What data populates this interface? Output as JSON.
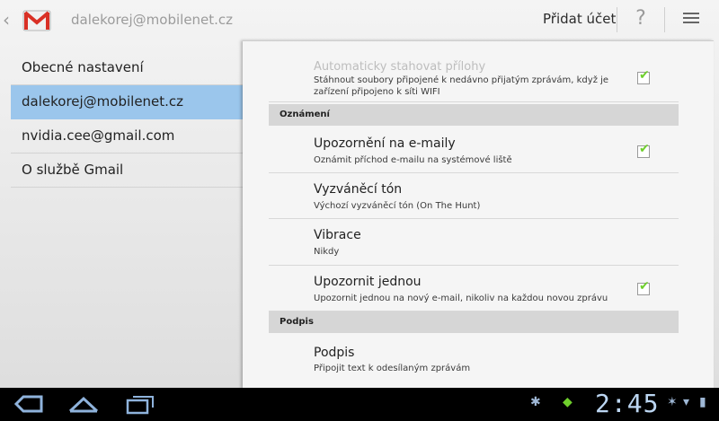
{
  "header": {
    "account": "dalekorej@mobilenet.cz",
    "add_account": "Přidat účet",
    "help_glyph": "?"
  },
  "left_menu": {
    "items": [
      {
        "label": "Obecné nastavení",
        "selected": false
      },
      {
        "label": "dalekorej@mobilenet.cz",
        "selected": true
      },
      {
        "label": "nvidia.cee@gmail.com",
        "selected": false
      },
      {
        "label": "O službě Gmail",
        "selected": false
      }
    ]
  },
  "settings": {
    "prefetch": {
      "title_partial": "Automaticky stahovat přílohy",
      "subtitle": "Stáhnout soubory připojené k nedávno přijatým zprávám, když je zařízení připojeno k síti WIFI",
      "checked": true
    },
    "section_notifications": "Oznámení",
    "email_notifications": {
      "title": "Upozornění na e-maily",
      "subtitle": "Oznámit příchod e-mailu na systémové liště",
      "checked": true
    },
    "ringtone": {
      "title": "Vyzváněcí tón",
      "subtitle": "Výchozí vyzváněcí tón (On The Hunt)"
    },
    "vibrate": {
      "title": "Vibrace",
      "subtitle": "Nikdy"
    },
    "notify_once": {
      "title": "Upozornit jednou",
      "subtitle": "Upozornit jednou na nový e-mail, nikoliv na každou novou zprávu",
      "checked": true
    },
    "section_signature": "Podpis",
    "signature": {
      "title": "Podpis",
      "subtitle": "Připojit text k odesílaným zprávám"
    }
  },
  "system_bar": {
    "clock": "2:45",
    "colors": {
      "accent": "#bcd6f2",
      "check": "#6fcf2c",
      "selected": "#9bc6ec"
    }
  }
}
